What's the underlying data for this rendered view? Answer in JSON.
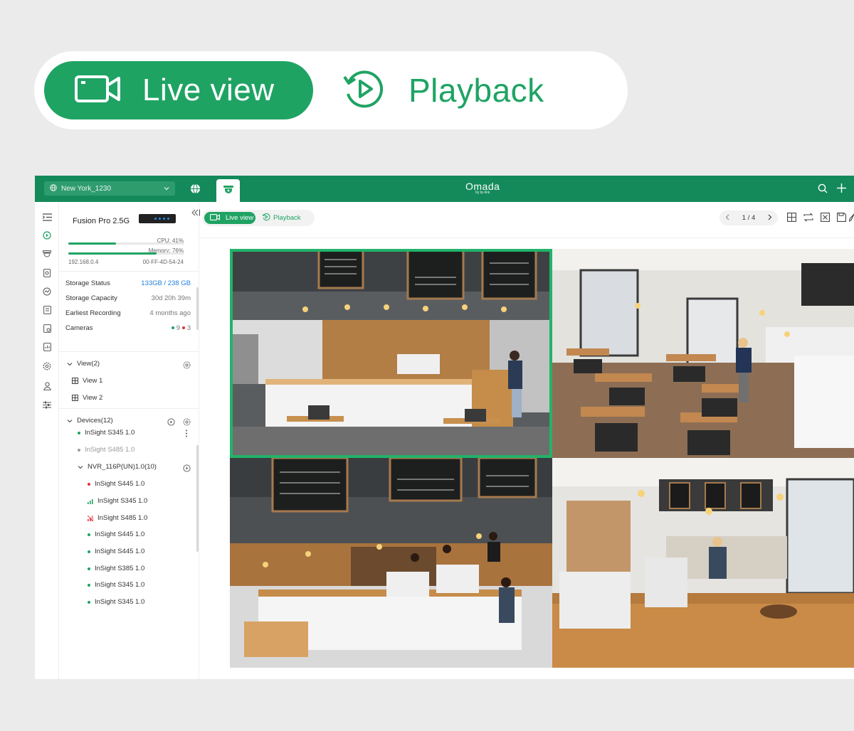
{
  "mode_switch": {
    "live_label": "Live view",
    "playback_label": "Playback",
    "active": "live"
  },
  "topbar": {
    "site": "New York_1230",
    "brand_name": "Omada",
    "brand_sub": "by tp-link"
  },
  "device": {
    "name": "Fusion Pro 2.5G",
    "cpu_label": "CPU: 41%",
    "cpu_percent": 41,
    "memory_label": "Memory: 76%",
    "memory_percent": 76,
    "ip": "192.168.0.4",
    "mac": "00-FF-4D-54-24"
  },
  "info": [
    {
      "label": "Storage Status",
      "value": "133GB / 238 GB"
    },
    {
      "label": "Storage Capacity",
      "value": "30d 20h 39m"
    },
    {
      "label": "Earliest Recording",
      "value": "4 months ago"
    },
    {
      "label": "Cameras",
      "online": "9",
      "offline": "3"
    }
  ],
  "views": {
    "header": "View(2)",
    "items": [
      "View 1",
      "View 2"
    ]
  },
  "devices": {
    "header": "Devices(12)",
    "items": [
      {
        "label": "InSight S345 1.0",
        "status": "online"
      },
      {
        "label": "InSight S485 1.0",
        "status": "offline"
      }
    ],
    "nvr": {
      "label": "NVR_116P(UN)1.0(10)",
      "children": [
        {
          "label": "InSight S445 1.0",
          "status": "alert"
        },
        {
          "label": "InSight S345 1.0",
          "status": "signal"
        },
        {
          "label": "InSight S485 1.0",
          "status": "weak-signal"
        },
        {
          "label": "InSight S445 1.0",
          "status": "online"
        },
        {
          "label": "InSight S445 1.0",
          "status": "online"
        },
        {
          "label": "InSight S385 1.0",
          "status": "online"
        },
        {
          "label": "InSight S345 1.0",
          "status": "online"
        },
        {
          "label": "InSight S345 1.0",
          "status": "online"
        }
      ]
    }
  },
  "main": {
    "mini_live_label": "Live view",
    "mini_playback_label": "Playback",
    "page_current": "1",
    "page_total": "/ 4",
    "selected_camera": 1
  },
  "colors": {
    "brand_green": "#1fa363",
    "topbar": "#148a5a",
    "online": "#1fa363",
    "alert": "#e0323c",
    "offline": "#9c9c9c"
  }
}
